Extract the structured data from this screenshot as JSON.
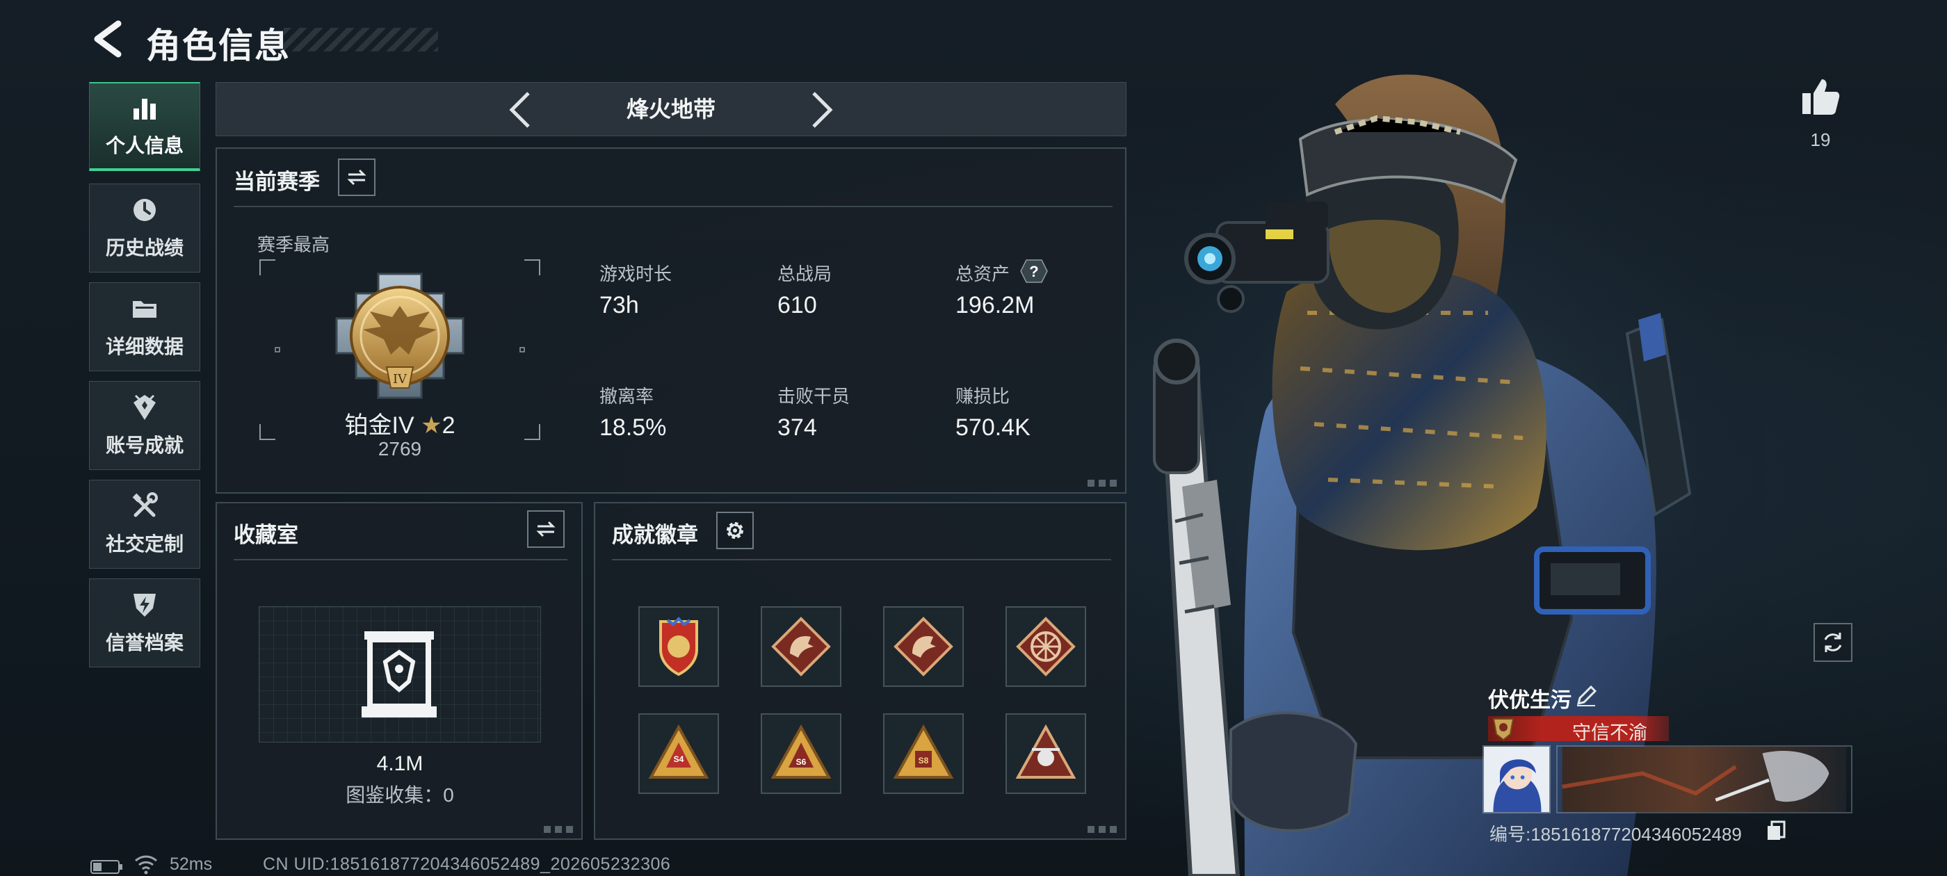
{
  "header": {
    "title": "角色信息"
  },
  "sidebar": {
    "items": [
      {
        "label": "个人信息",
        "icon": "bar-chart-icon",
        "active": true
      },
      {
        "label": "历史战绩",
        "icon": "history-icon",
        "active": false
      },
      {
        "label": "详细数据",
        "icon": "folder-icon",
        "active": false
      },
      {
        "label": "账号成就",
        "icon": "achievement-icon",
        "active": false
      },
      {
        "label": "社交定制",
        "icon": "tools-icon",
        "active": false
      },
      {
        "label": "信誉档案",
        "icon": "credit-shield-icon",
        "active": false
      }
    ]
  },
  "mode": {
    "title": "烽火地带"
  },
  "season": {
    "title": "当前赛季",
    "best_label": "赛季最高",
    "rank_name": "铂金IV",
    "rank_stars": "2",
    "rank_score": "2769",
    "stats": [
      {
        "label": "游戏时长",
        "value": "73h"
      },
      {
        "label": "总战局",
        "value": "610"
      },
      {
        "label": "总资产",
        "value": "196.2M"
      },
      {
        "label": "撤离率",
        "value": "18.5%"
      },
      {
        "label": "击败干员",
        "value": "374"
      },
      {
        "label": "赚损比",
        "value": "570.4K"
      }
    ],
    "help_symbol": "?"
  },
  "collection": {
    "title": "收藏室",
    "value": "4.1M",
    "count_text": "图鉴收集：0"
  },
  "badges": {
    "title": "成就徽章",
    "items": [
      "badge-1",
      "badge-2",
      "badge-3",
      "badge-4",
      "badge-5",
      "badge-6",
      "badge-7",
      "badge-8"
    ]
  },
  "profile": {
    "likes": "19",
    "name": "伏优生污",
    "title_banner": "守信不渝",
    "id_text": "编号:185161877204346052489"
  },
  "footer": {
    "ping": "52ms",
    "uid": "CN UID:185161877204346052489_202605232306"
  },
  "colors": {
    "accent_green": "#41d092",
    "banner_red": "#b3231d",
    "gold": "#c9a356"
  }
}
